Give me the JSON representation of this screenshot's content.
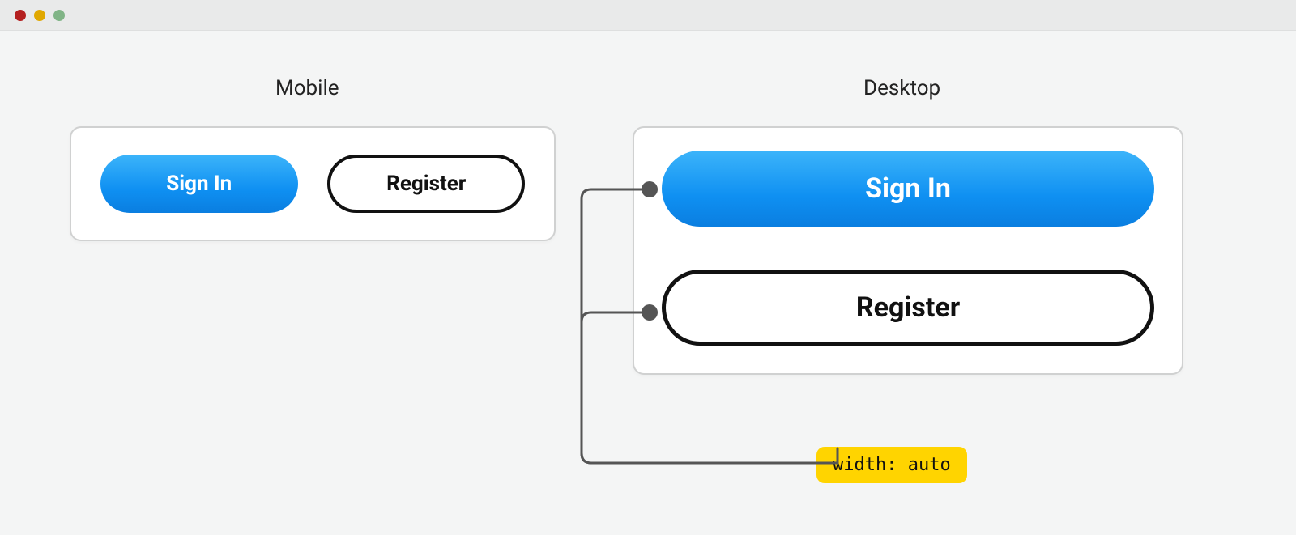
{
  "labels": {
    "mobile": "Mobile",
    "desktop": "Desktop"
  },
  "mobile": {
    "signin_label": "Sign In",
    "register_label": "Register"
  },
  "desktop": {
    "signin_label": "Sign In",
    "register_label": "Register"
  },
  "annotation": {
    "width_auto": "width: auto"
  },
  "colors": {
    "primary_gradient_top": "#3cb4fa",
    "primary_gradient_bottom": "#0a7ee0",
    "outline": "#111111",
    "badge_bg": "#ffd400",
    "card_border": "#d0d1d1",
    "page_bg": "#f4f5f5"
  }
}
